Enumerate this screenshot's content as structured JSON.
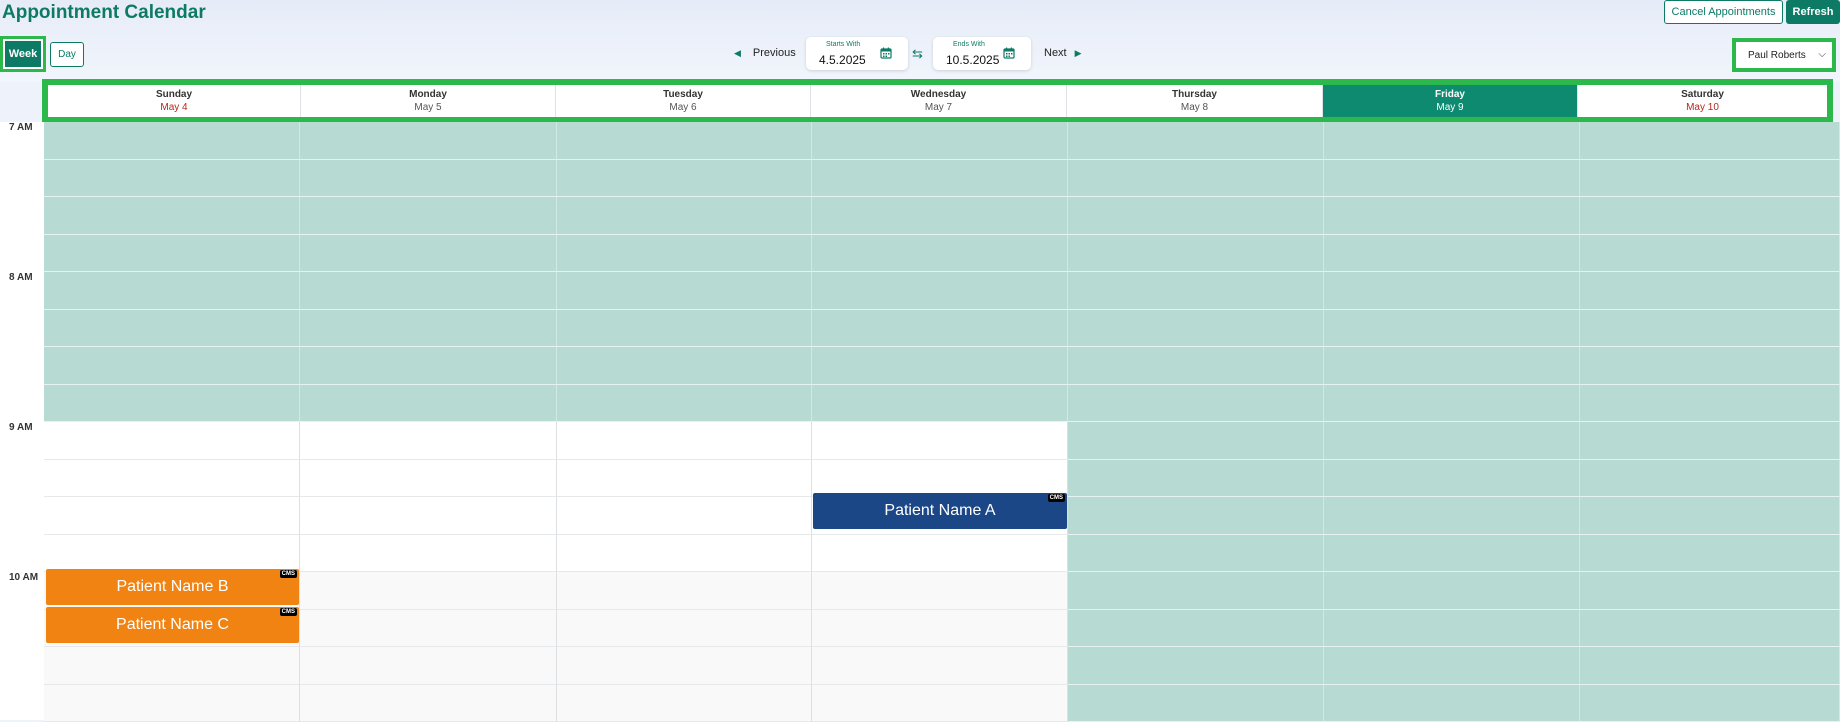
{
  "app": {
    "title": "Appointment Calendar",
    "cancel_label": "Cancel Appointments",
    "refresh_label": "Refresh"
  },
  "view": {
    "week_label": "Week",
    "day_label": "Day"
  },
  "nav": {
    "previous_label": "Previous",
    "next_label": "Next",
    "start_label": "Starts With",
    "start_value": "4.5.2025",
    "end_label": "Ends With",
    "end_value": "10.5.2025"
  },
  "provider": {
    "selected": "Paul Roberts"
  },
  "days": [
    {
      "name": "Sunday",
      "date": "May 4",
      "weekend": true
    },
    {
      "name": "Monday",
      "date": "May 5"
    },
    {
      "name": "Tuesday",
      "date": "May 6"
    },
    {
      "name": "Wednesday",
      "date": "May 7"
    },
    {
      "name": "Thursday",
      "date": "May 8"
    },
    {
      "name": "Friday",
      "date": "May 9",
      "today": true
    },
    {
      "name": "Saturday",
      "date": "May 10",
      "weekend": true
    }
  ],
  "times": [
    "7 AM",
    "8 AM",
    "9 AM",
    "10 AM"
  ],
  "appointments": [
    {
      "name": "Patient Name A",
      "badge": "CMS",
      "color": "#1b4787"
    },
    {
      "name": "Patient Name B",
      "badge": "CMS",
      "color": "#f08312"
    },
    {
      "name": "Patient Name C",
      "badge": "CMS",
      "color": "#f08312"
    }
  ],
  "colors": {
    "brand": "#0d7a66",
    "highlight_outline": "#2db84c",
    "unavailable": "#b7dbd3"
  }
}
